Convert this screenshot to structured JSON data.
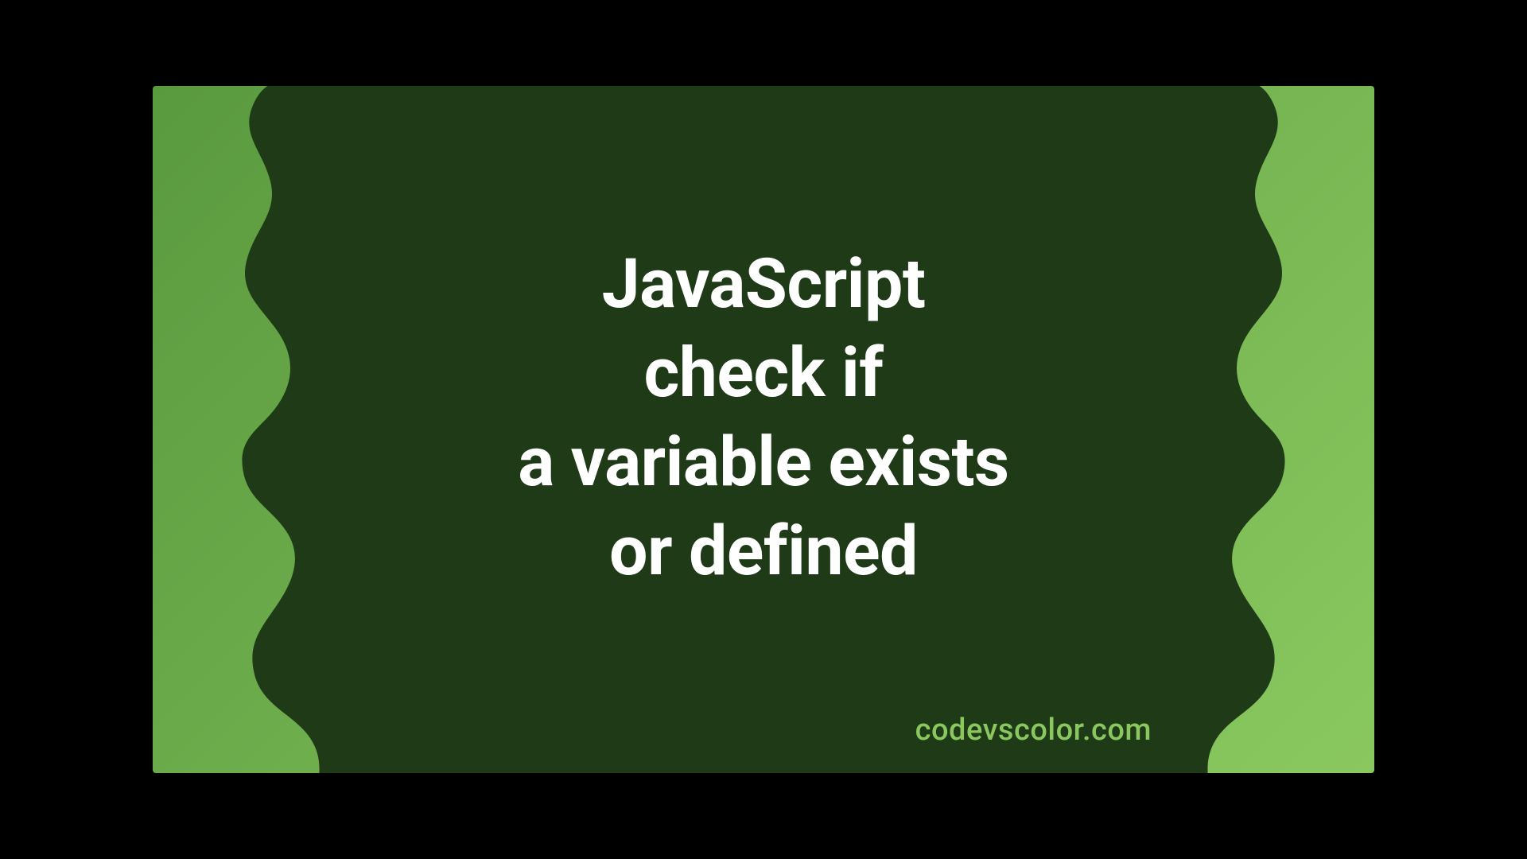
{
  "title": {
    "line1": "JavaScript",
    "line2": "check if",
    "line3": "a variable exists",
    "line4": "or defined"
  },
  "watermark": "codevscolor.com",
  "colors": {
    "blob": "#1e3a16",
    "gradient_start": "#5a9a3f",
    "gradient_end": "#8ac85f",
    "text": "#ffffff",
    "watermark": "#8ac85f"
  }
}
